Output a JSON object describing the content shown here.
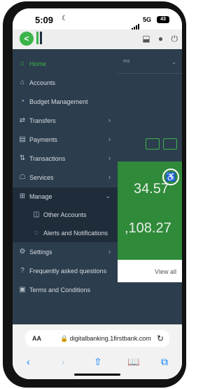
{
  "status_bar": {
    "time": "5:09",
    "network": "5G",
    "battery": "43"
  },
  "header": {
    "logo_letter": "<"
  },
  "background": {
    "tab_text": "ms",
    "balance_1": "34.57",
    "balance_2": ",108.27",
    "view_all": "View all"
  },
  "nav": {
    "items": [
      {
        "label": "Home",
        "icon": "home-icon",
        "glyph": "⌂",
        "chevron": ""
      },
      {
        "label": "Accounts",
        "icon": "bank-icon",
        "glyph": "🏛",
        "chevron": ""
      },
      {
        "label": "Budget Management",
        "icon": "budget-icon",
        "glyph": "◔",
        "chevron": ""
      },
      {
        "label": "Transfers",
        "icon": "transfer-icon",
        "glyph": "⇄",
        "chevron": "›"
      },
      {
        "label": "Payments",
        "icon": "payment-icon",
        "glyph": "▤",
        "chevron": "›"
      },
      {
        "label": "Transactions",
        "icon": "transactions-icon",
        "glyph": "⇅",
        "chevron": "›"
      },
      {
        "label": "Services",
        "icon": "services-icon",
        "glyph": "☖",
        "chevron": "›"
      },
      {
        "label": "Manage",
        "icon": "manage-icon",
        "glyph": "⊞",
        "chevron": "⌄"
      },
      {
        "label": "Other Accounts",
        "icon": "other-accounts-icon",
        "glyph": "◫",
        "chevron": ""
      },
      {
        "label": "Alerts and Notifications",
        "icon": "alerts-icon",
        "glyph": "◌",
        "chevron": ""
      },
      {
        "label": "Settings",
        "icon": "settings-icon",
        "glyph": "⚙",
        "chevron": "›"
      },
      {
        "label": "Frequently asked questions",
        "icon": "faq-icon",
        "glyph": "?",
        "chevron": ""
      },
      {
        "label": "Terms and Conditions",
        "icon": "terms-icon",
        "glyph": "▣",
        "chevron": ""
      }
    ]
  },
  "safari": {
    "aa": "AA",
    "url": "digitalbanking.1firstbank.com"
  },
  "colors": {
    "accent": "#3bb44a",
    "nav_bg": "#2c3d4d",
    "nav_selected": "#1f2d3b"
  }
}
